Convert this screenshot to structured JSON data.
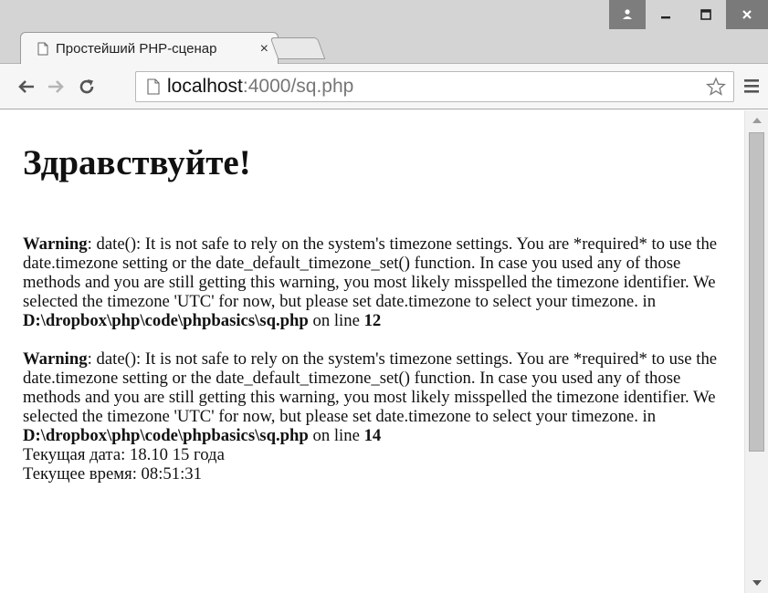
{
  "browser": {
    "tab_title": "Простейший PHP-сценар",
    "tab_close": "×",
    "url_host": "localhost",
    "url_rest": ":4000/sq.php"
  },
  "page": {
    "heading": "Здравствуйте!",
    "warnings": [
      {
        "label": "Warning",
        "message": ": date(): It is not safe to rely on the system's timezone settings. You are *required* to use the date.timezone setting or the date_default_timezone_set() function. In case you used any of those methods and you are still getting this warning, you most likely misspelled the timezone identifier. We selected the timezone 'UTC' for now, but please set date.timezone to select your timezone. in ",
        "file": "D:\\dropbox\\php\\code\\phpbasics\\sq.php",
        "on_line": " on line ",
        "line": "12"
      },
      {
        "label": "Warning",
        "message": ": date(): It is not safe to rely on the system's timezone settings. You are *required* to use the date.timezone setting or the date_default_timezone_set() function. In case you used any of those methods and you are still getting this warning, you most likely misspelled the timezone identifier. We selected the timezone 'UTC' for now, but please set date.timezone to select your timezone. in ",
        "file": "D:\\dropbox\\php\\code\\phpbasics\\sq.php",
        "on_line": " on line ",
        "line": "14"
      }
    ],
    "current_date": "Текущая дата: 18.10 15 года",
    "current_time": "Текущее время: 08:51:31"
  },
  "icons": {
    "back": "arrow-left-icon",
    "forward": "arrow-right-icon",
    "reload": "reload-icon",
    "star": "star-icon",
    "menu": "hamburger-menu-icon",
    "user": "user-icon",
    "minimize": "minimize-icon",
    "maximize": "maximize-icon",
    "close": "close-icon"
  }
}
